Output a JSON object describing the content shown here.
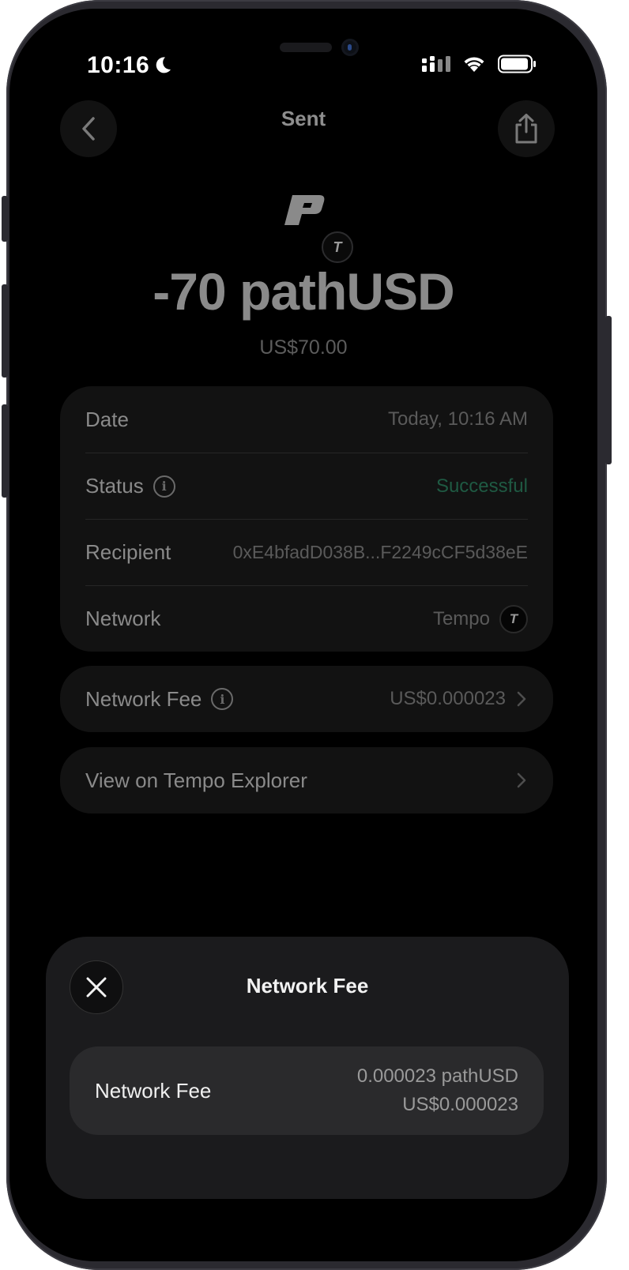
{
  "status_bar": {
    "time": "10:16"
  },
  "header": {
    "title": "Sent"
  },
  "token": {
    "logo_glyph": "P",
    "network_glyph": "T"
  },
  "transaction": {
    "amount": "-70 pathUSD",
    "fiat": "US$70.00"
  },
  "details": [
    {
      "label": "Date",
      "value": "Today, 10:16 AM"
    },
    {
      "label": "Status",
      "value": "Successful"
    },
    {
      "label": "Recipient",
      "value": "0xE4bfadD038B...F2249cCF5d38eE"
    },
    {
      "label": "Network",
      "value": "Tempo"
    }
  ],
  "fee_row": {
    "label": "Network Fee",
    "value": "US$0.000023"
  },
  "explorer": {
    "label": "View on Tempo Explorer"
  },
  "sheet": {
    "title": "Network Fee",
    "row_label": "Network Fee",
    "token_amount": "0.000023 pathUSD",
    "fiat_amount": "US$0.000023"
  },
  "colors": {
    "success": "#1f5a43",
    "background": "#000000",
    "card": "#121212",
    "sheet": "#1b1b1d"
  }
}
